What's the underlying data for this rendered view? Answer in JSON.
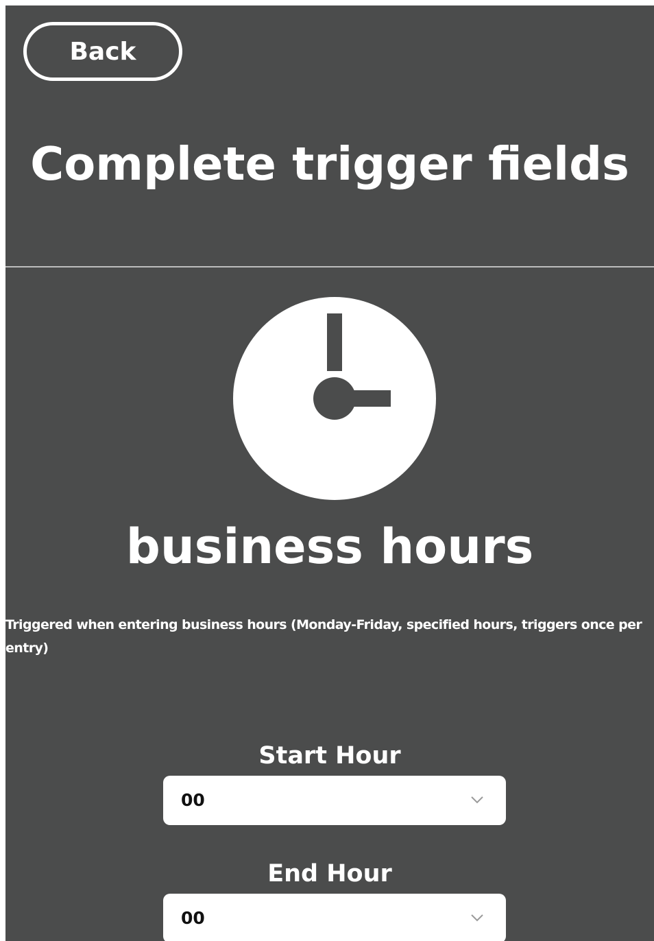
{
  "header": {
    "back_label": "Back",
    "title": "Complete trigger fields"
  },
  "trigger": {
    "icon": "clock-icon",
    "name": "business hours",
    "description": "Triggered when entering business hours (Monday-Friday, specified hours, triggers once per entry)"
  },
  "fields": {
    "start_hour": {
      "label": "Start Hour",
      "value": "00"
    },
    "end_hour": {
      "label": "End Hour",
      "value": "00"
    }
  },
  "colors": {
    "background": "#4b4c4c",
    "foreground": "#ffffff",
    "divider": "#bdbdbd",
    "select_background": "#ffffff",
    "select_text": "#111111",
    "chevron": "#9a9a9a"
  }
}
